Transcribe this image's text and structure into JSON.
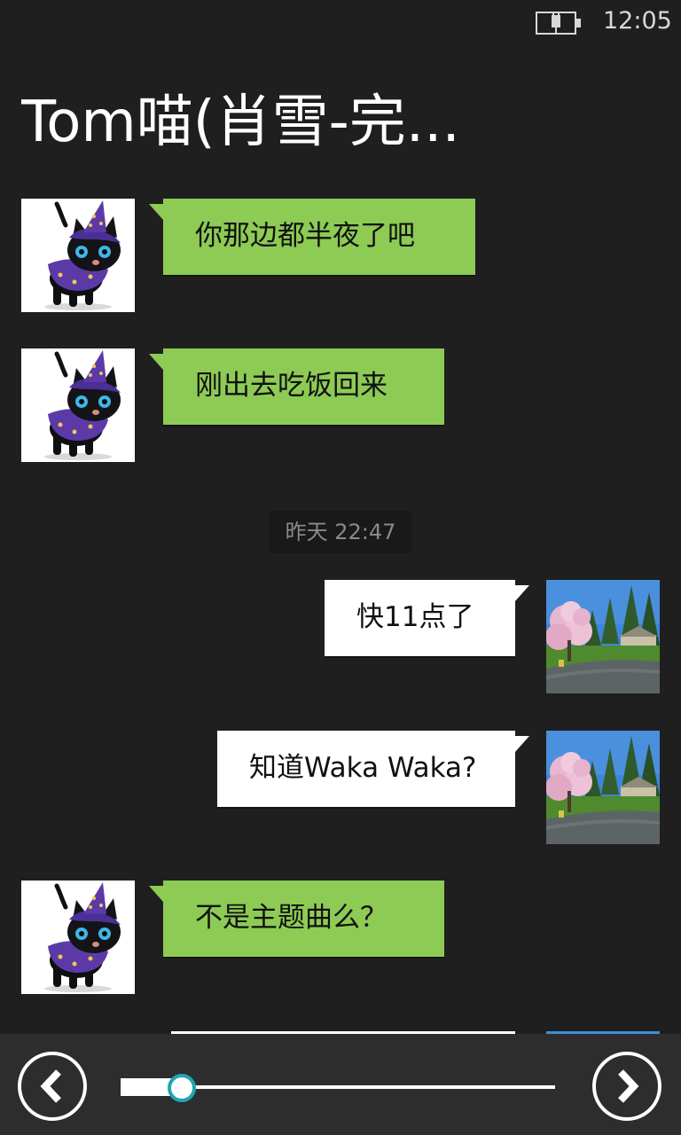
{
  "status_bar": {
    "time": "12:05",
    "battery_icon": "battery-charging-icon"
  },
  "header": {
    "title": "Tom喵(肖雪-完..."
  },
  "messages": [
    {
      "direction": "in",
      "avatar": "black-cat-witch-hat-avatar",
      "text": "你那边都半夜了吧"
    },
    {
      "direction": "in",
      "avatar": "black-cat-witch-hat-avatar",
      "text": "刚出去吃饭回来"
    },
    {
      "type": "timestamp",
      "text": "昨天 22:47"
    },
    {
      "direction": "out",
      "avatar": "cherry-blossom-landscape-avatar",
      "text": "快11点了"
    },
    {
      "direction": "out",
      "avatar": "cherry-blossom-landscape-avatar",
      "text": "知道Waka Waka?"
    },
    {
      "direction": "in",
      "avatar": "black-cat-witch-hat-avatar",
      "text": "不是主题曲么？"
    }
  ],
  "bottom_bar": {
    "prev_icon": "chevron-left-icon",
    "next_icon": "chevron-right-icon",
    "slider_position": 0.14
  },
  "colors": {
    "background": "#1f1f1f",
    "incoming_bubble": "#8dcb55",
    "outgoing_bubble": "#ffffff",
    "slider_accent": "#1ea6b4"
  }
}
